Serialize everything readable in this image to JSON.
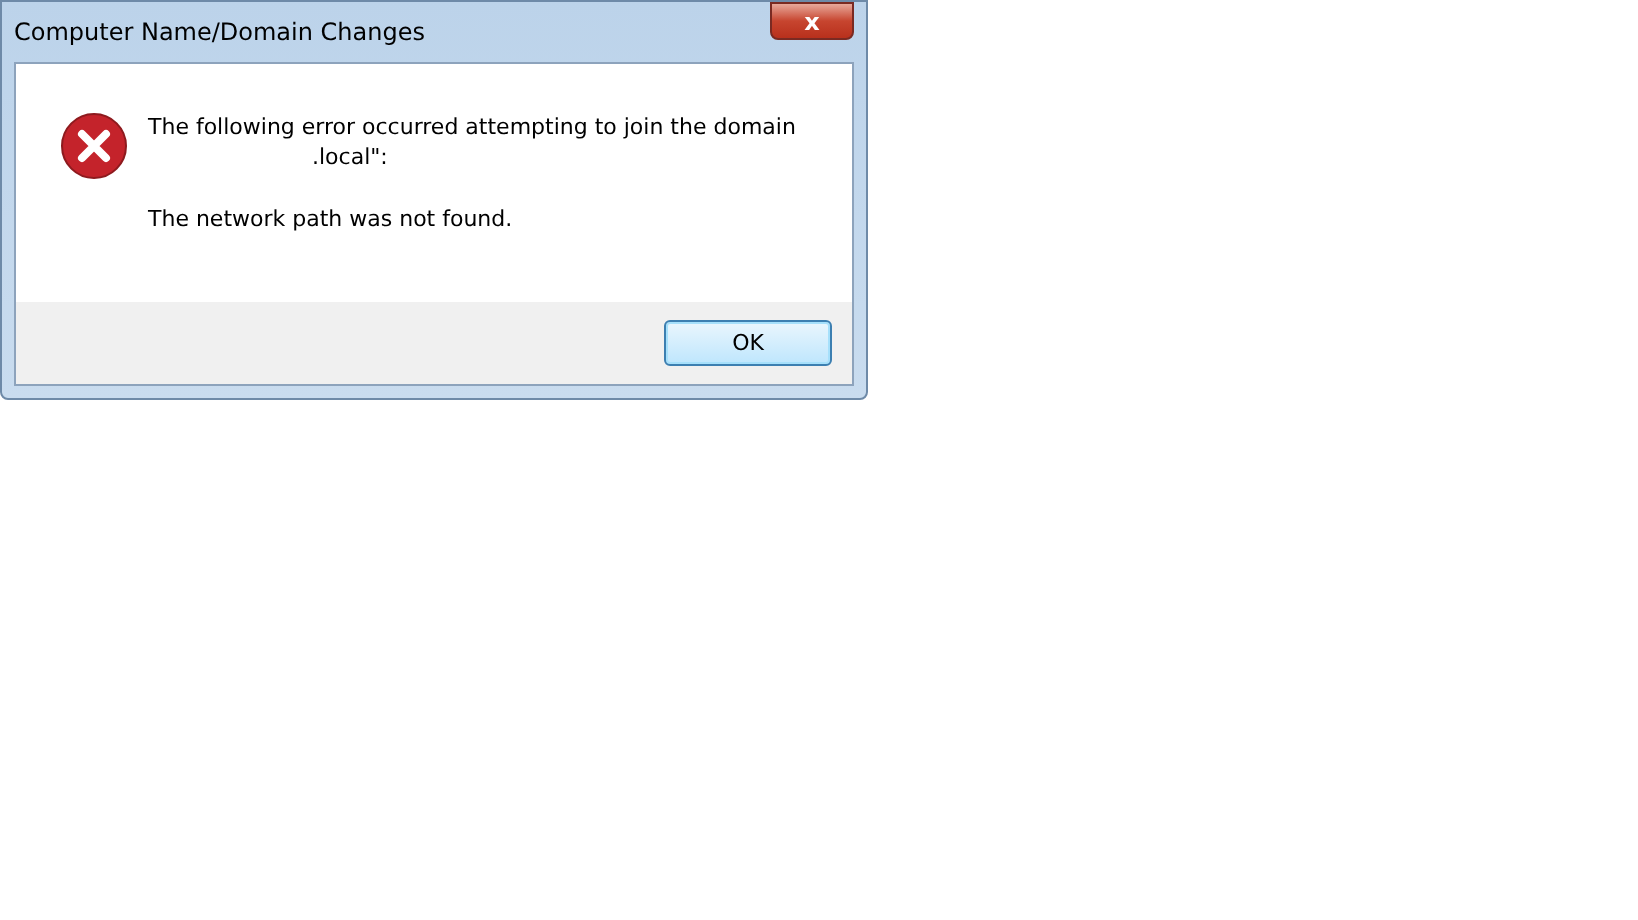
{
  "window": {
    "title": "Computer Name/Domain Changes",
    "close_label": "x"
  },
  "message": {
    "lines": [
      "The following error occurred attempting to join the domain",
      ".local\":"
    ],
    "detail": "The network path was not found."
  },
  "buttons": [
    {
      "label": "OK",
      "default": true
    }
  ]
}
